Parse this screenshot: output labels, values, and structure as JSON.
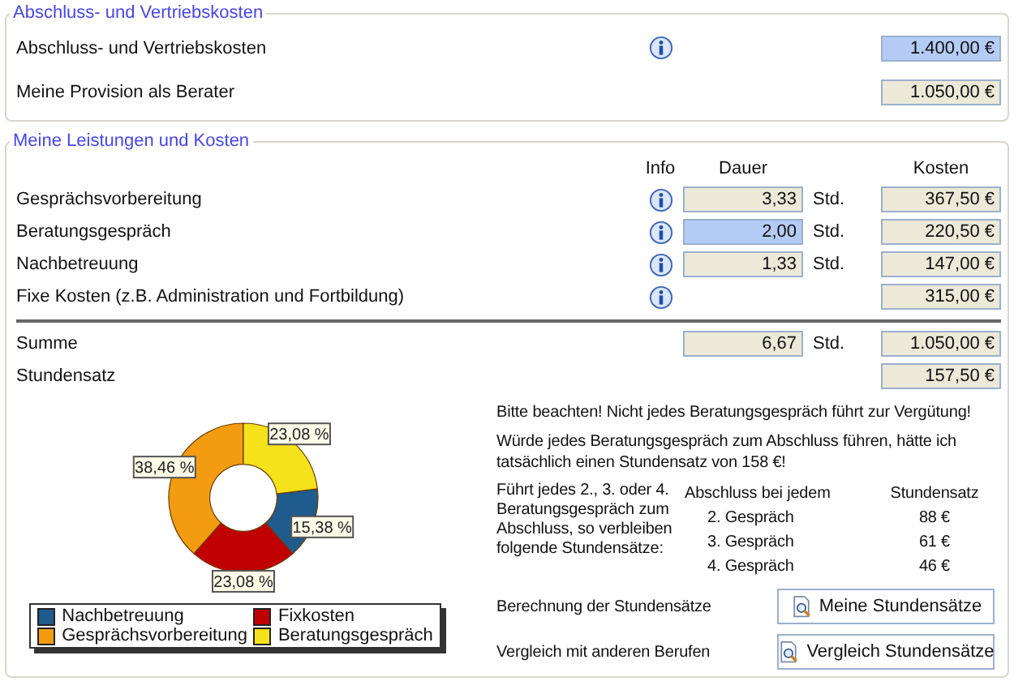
{
  "section_1": {
    "title": "Abschluss- und Vertriebskosten",
    "rows": [
      {
        "label": "Abschluss- und Vertriebskosten",
        "info": true,
        "value": "1.400,00 €",
        "editable": true
      },
      {
        "label": "Meine Provision als Berater",
        "info": false,
        "value": "1.050,00 €",
        "editable": false
      }
    ]
  },
  "section_2": {
    "title": "Meine Leistungen und Kosten",
    "columns": [
      "Info",
      "Dauer",
      "Kosten"
    ],
    "rows": [
      {
        "label": "Gesprächsvorbereitung",
        "info": true,
        "duration": "3,33",
        "duration_editable": false,
        "unit": "Std.",
        "cost": "367,50 €"
      },
      {
        "label": "Beratungsgespräch",
        "info": true,
        "duration": "2,00",
        "duration_editable": true,
        "unit": "Std.",
        "cost": "220,50 €"
      },
      {
        "label": "Nachbetreuung",
        "info": true,
        "duration": "1,33",
        "duration_editable": false,
        "unit": "Std.",
        "cost": "147,00 €"
      },
      {
        "label": "Fixe Kosten (z.B. Administration und Fortbildung)",
        "info": true,
        "cost": "315,00 €"
      }
    ],
    "totals": [
      {
        "label": "Summe",
        "duration": "6,67",
        "unit": "Std.",
        "cost": "1.050,00 €"
      },
      {
        "label": "Stundensatz",
        "cost": "157,50 €"
      }
    ],
    "chart_data": {
      "type": "donut",
      "legend": "bottom",
      "categories": [
        "Nachbetreuung",
        "Fixkosten",
        "Gesprächsvorbereitung",
        "Beratungsgespräch"
      ],
      "values": [
        15.38,
        23.08,
        38.46,
        23.08
      ],
      "colors": [
        "#1f5b8c",
        "#c00000",
        "#f39c12",
        "#f5e21a"
      ],
      "value_labels": [
        "15,38 %",
        "23,08 %",
        "38,46 %",
        "23,08 %"
      ]
    },
    "notes": [
      "Bitte beachten! Nicht jedes Beratungsgespräch führt zur Vergütung!",
      "Würde jedes Beratungsgespräch zum Abschluss führen, hätte ich tatsächlich einen Stundensatz von 158 €!"
    ],
    "scenario_text": "Führt jedes 2., 3. oder 4. Beratungsgespräch zum Abschluss, so verbleiben folgende Stundensätze:",
    "scenario_columns": [
      "Abschluss bei jedem",
      "Stundensatz"
    ],
    "scenarios": [
      {
        "case": "2. Gespräch",
        "rate": "88 €"
      },
      {
        "case": "3. Gespräch",
        "rate": "61 €"
      },
      {
        "case": "4. Gespräch",
        "rate": "46 €"
      }
    ],
    "actions": [
      {
        "label": "Berechnung der Stundensätze",
        "button": "Meine Stundensätze"
      },
      {
        "label": "Vergleich mit anderen Berufen",
        "button": "Vergleich Stundensätze"
      }
    ]
  }
}
